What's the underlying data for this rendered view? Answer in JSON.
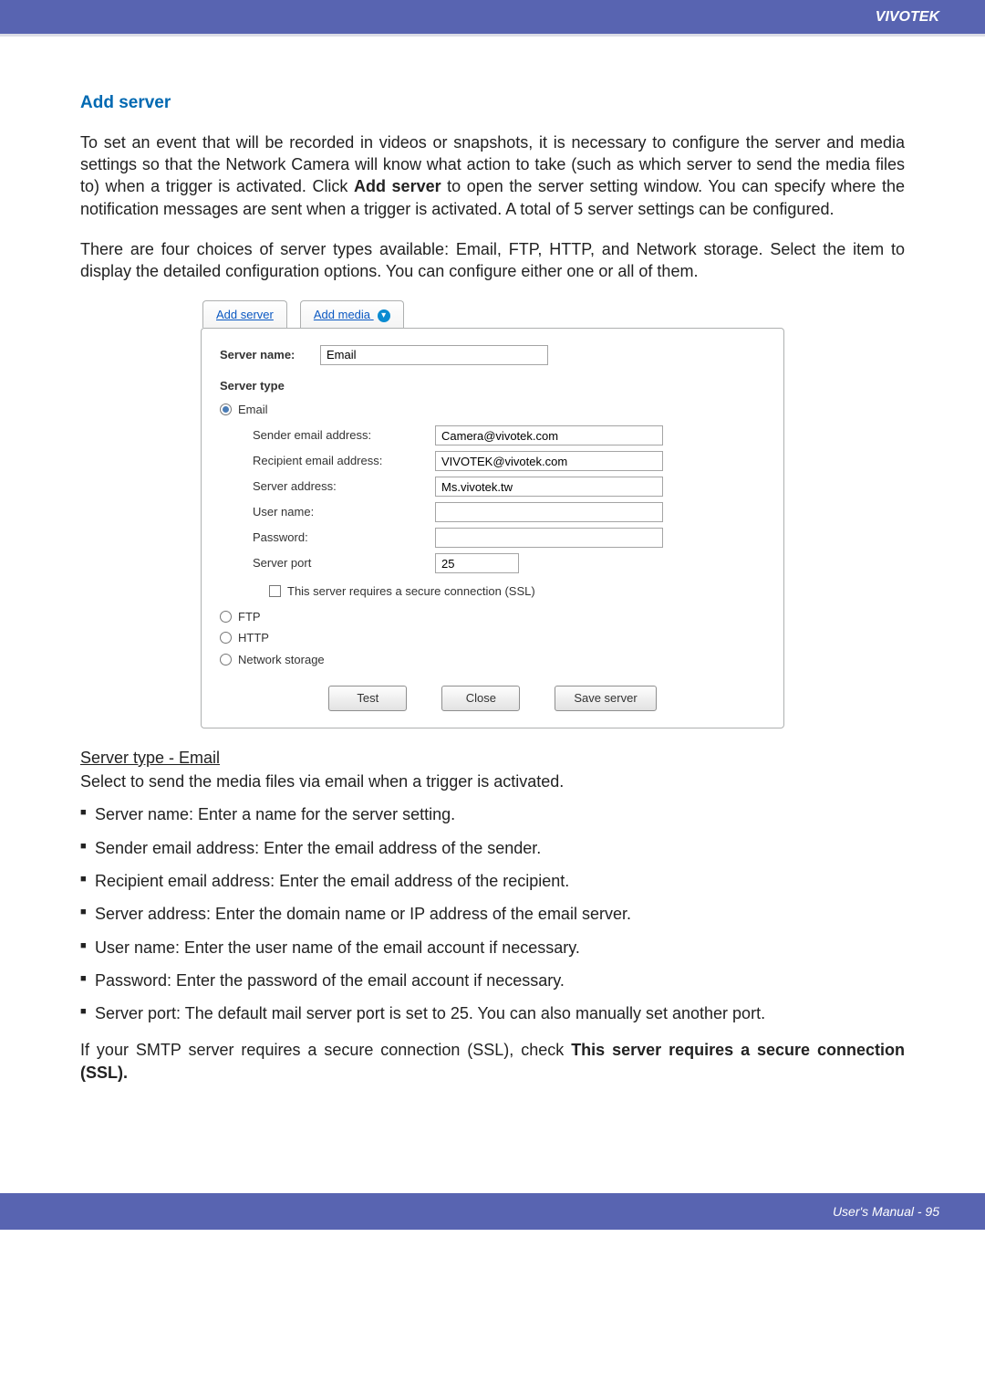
{
  "header": {
    "brand": "VIVOTEK"
  },
  "section_title": "Add server",
  "para1": "To set an event that will be recorded in videos or snapshots, it is necessary to configure the server and media settings so that the Network Camera will know what action to take (such as which server to send the media files to) when a trigger is activated. Click ",
  "para1_bold": "Add server",
  "para1_tail": " to open the server setting window. You can specify where the notification messages are sent when a trigger is activated. A total of 5 server settings can be configured.",
  "para2": "There are four choices of server types available: Email, FTP, HTTP, and Network storage. Select the item to display the detailed configuration options. You can configure either one or all of them.",
  "dialog": {
    "tabs": {
      "add_server": "Add server",
      "add_media": "Add media"
    },
    "server_name_label": "Server name:",
    "server_name_value": "Email",
    "server_type_label": "Server type",
    "types": {
      "email": "Email",
      "ftp": "FTP",
      "http": "HTTP",
      "network": "Network storage"
    },
    "fields": {
      "sender_label": "Sender email address:",
      "sender_value": "Camera@vivotek.com",
      "recipient_label": "Recipient email address:",
      "recipient_value": "VIVOTEK@vivotek.com",
      "server_addr_label": "Server address:",
      "server_addr_value": "Ms.vivotek.tw",
      "user_label": "User name:",
      "user_value": "",
      "pass_label": "Password:",
      "pass_value": "",
      "port_label": "Server port",
      "port_value": "25",
      "ssl_label": "This server requires a secure connection (SSL)"
    },
    "buttons": {
      "test": "Test",
      "close": "Close",
      "save": "Save server"
    }
  },
  "subhead": "Server type - Email",
  "subhead_desc": "Select to send the media files via email when a trigger is activated.",
  "bullets": [
    "Server name: Enter a name for the server setting.",
    "Sender email address: Enter the email address of the sender.",
    "Recipient email address: Enter the email address of the recipient.",
    "Server address: Enter the domain name or IP address of the email server.",
    "User name: Enter the user name of the email account if necessary.",
    "Password: Enter the password of the email account if necessary.",
    "Server port: The default mail server port is set to 25. You can also manually set another port."
  ],
  "closing_pre": "If your SMTP server requires a secure connection (SSL), check ",
  "closing_bold": "This server requires a secure connection (SSL).",
  "footer": {
    "text": "User's Manual - 95"
  }
}
